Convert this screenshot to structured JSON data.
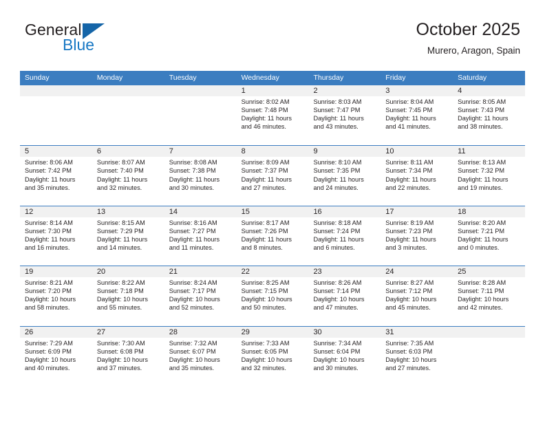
{
  "brand": {
    "name_part1": "General",
    "name_part2": "Blue",
    "accent_color": "#1878c4",
    "triangle_color": "#1565a8"
  },
  "header": {
    "title": "October 2025",
    "subtitle": "Murero, Aragon, Spain",
    "header_bar_color": "#3b7dc0"
  },
  "weekdays": [
    "Sunday",
    "Monday",
    "Tuesday",
    "Wednesday",
    "Thursday",
    "Friday",
    "Saturday"
  ],
  "weeks": [
    [
      {
        "day": "",
        "sunrise": "",
        "sunset": "",
        "daylight1": "",
        "daylight2": ""
      },
      {
        "day": "",
        "sunrise": "",
        "sunset": "",
        "daylight1": "",
        "daylight2": ""
      },
      {
        "day": "",
        "sunrise": "",
        "sunset": "",
        "daylight1": "",
        "daylight2": ""
      },
      {
        "day": "1",
        "sunrise": "Sunrise: 8:02 AM",
        "sunset": "Sunset: 7:48 PM",
        "daylight1": "Daylight: 11 hours",
        "daylight2": "and 46 minutes."
      },
      {
        "day": "2",
        "sunrise": "Sunrise: 8:03 AM",
        "sunset": "Sunset: 7:47 PM",
        "daylight1": "Daylight: 11 hours",
        "daylight2": "and 43 minutes."
      },
      {
        "day": "3",
        "sunrise": "Sunrise: 8:04 AM",
        "sunset": "Sunset: 7:45 PM",
        "daylight1": "Daylight: 11 hours",
        "daylight2": "and 41 minutes."
      },
      {
        "day": "4",
        "sunrise": "Sunrise: 8:05 AM",
        "sunset": "Sunset: 7:43 PM",
        "daylight1": "Daylight: 11 hours",
        "daylight2": "and 38 minutes."
      }
    ],
    [
      {
        "day": "5",
        "sunrise": "Sunrise: 8:06 AM",
        "sunset": "Sunset: 7:42 PM",
        "daylight1": "Daylight: 11 hours",
        "daylight2": "and 35 minutes."
      },
      {
        "day": "6",
        "sunrise": "Sunrise: 8:07 AM",
        "sunset": "Sunset: 7:40 PM",
        "daylight1": "Daylight: 11 hours",
        "daylight2": "and 32 minutes."
      },
      {
        "day": "7",
        "sunrise": "Sunrise: 8:08 AM",
        "sunset": "Sunset: 7:38 PM",
        "daylight1": "Daylight: 11 hours",
        "daylight2": "and 30 minutes."
      },
      {
        "day": "8",
        "sunrise": "Sunrise: 8:09 AM",
        "sunset": "Sunset: 7:37 PM",
        "daylight1": "Daylight: 11 hours",
        "daylight2": "and 27 minutes."
      },
      {
        "day": "9",
        "sunrise": "Sunrise: 8:10 AM",
        "sunset": "Sunset: 7:35 PM",
        "daylight1": "Daylight: 11 hours",
        "daylight2": "and 24 minutes."
      },
      {
        "day": "10",
        "sunrise": "Sunrise: 8:11 AM",
        "sunset": "Sunset: 7:34 PM",
        "daylight1": "Daylight: 11 hours",
        "daylight2": "and 22 minutes."
      },
      {
        "day": "11",
        "sunrise": "Sunrise: 8:13 AM",
        "sunset": "Sunset: 7:32 PM",
        "daylight1": "Daylight: 11 hours",
        "daylight2": "and 19 minutes."
      }
    ],
    [
      {
        "day": "12",
        "sunrise": "Sunrise: 8:14 AM",
        "sunset": "Sunset: 7:30 PM",
        "daylight1": "Daylight: 11 hours",
        "daylight2": "and 16 minutes."
      },
      {
        "day": "13",
        "sunrise": "Sunrise: 8:15 AM",
        "sunset": "Sunset: 7:29 PM",
        "daylight1": "Daylight: 11 hours",
        "daylight2": "and 14 minutes."
      },
      {
        "day": "14",
        "sunrise": "Sunrise: 8:16 AM",
        "sunset": "Sunset: 7:27 PM",
        "daylight1": "Daylight: 11 hours",
        "daylight2": "and 11 minutes."
      },
      {
        "day": "15",
        "sunrise": "Sunrise: 8:17 AM",
        "sunset": "Sunset: 7:26 PM",
        "daylight1": "Daylight: 11 hours",
        "daylight2": "and 8 minutes."
      },
      {
        "day": "16",
        "sunrise": "Sunrise: 8:18 AM",
        "sunset": "Sunset: 7:24 PM",
        "daylight1": "Daylight: 11 hours",
        "daylight2": "and 6 minutes."
      },
      {
        "day": "17",
        "sunrise": "Sunrise: 8:19 AM",
        "sunset": "Sunset: 7:23 PM",
        "daylight1": "Daylight: 11 hours",
        "daylight2": "and 3 minutes."
      },
      {
        "day": "18",
        "sunrise": "Sunrise: 8:20 AM",
        "sunset": "Sunset: 7:21 PM",
        "daylight1": "Daylight: 11 hours",
        "daylight2": "and 0 minutes."
      }
    ],
    [
      {
        "day": "19",
        "sunrise": "Sunrise: 8:21 AM",
        "sunset": "Sunset: 7:20 PM",
        "daylight1": "Daylight: 10 hours",
        "daylight2": "and 58 minutes."
      },
      {
        "day": "20",
        "sunrise": "Sunrise: 8:22 AM",
        "sunset": "Sunset: 7:18 PM",
        "daylight1": "Daylight: 10 hours",
        "daylight2": "and 55 minutes."
      },
      {
        "day": "21",
        "sunrise": "Sunrise: 8:24 AM",
        "sunset": "Sunset: 7:17 PM",
        "daylight1": "Daylight: 10 hours",
        "daylight2": "and 52 minutes."
      },
      {
        "day": "22",
        "sunrise": "Sunrise: 8:25 AM",
        "sunset": "Sunset: 7:15 PM",
        "daylight1": "Daylight: 10 hours",
        "daylight2": "and 50 minutes."
      },
      {
        "day": "23",
        "sunrise": "Sunrise: 8:26 AM",
        "sunset": "Sunset: 7:14 PM",
        "daylight1": "Daylight: 10 hours",
        "daylight2": "and 47 minutes."
      },
      {
        "day": "24",
        "sunrise": "Sunrise: 8:27 AM",
        "sunset": "Sunset: 7:12 PM",
        "daylight1": "Daylight: 10 hours",
        "daylight2": "and 45 minutes."
      },
      {
        "day": "25",
        "sunrise": "Sunrise: 8:28 AM",
        "sunset": "Sunset: 7:11 PM",
        "daylight1": "Daylight: 10 hours",
        "daylight2": "and 42 minutes."
      }
    ],
    [
      {
        "day": "26",
        "sunrise": "Sunrise: 7:29 AM",
        "sunset": "Sunset: 6:09 PM",
        "daylight1": "Daylight: 10 hours",
        "daylight2": "and 40 minutes."
      },
      {
        "day": "27",
        "sunrise": "Sunrise: 7:30 AM",
        "sunset": "Sunset: 6:08 PM",
        "daylight1": "Daylight: 10 hours",
        "daylight2": "and 37 minutes."
      },
      {
        "day": "28",
        "sunrise": "Sunrise: 7:32 AM",
        "sunset": "Sunset: 6:07 PM",
        "daylight1": "Daylight: 10 hours",
        "daylight2": "and 35 minutes."
      },
      {
        "day": "29",
        "sunrise": "Sunrise: 7:33 AM",
        "sunset": "Sunset: 6:05 PM",
        "daylight1": "Daylight: 10 hours",
        "daylight2": "and 32 minutes."
      },
      {
        "day": "30",
        "sunrise": "Sunrise: 7:34 AM",
        "sunset": "Sunset: 6:04 PM",
        "daylight1": "Daylight: 10 hours",
        "daylight2": "and 30 minutes."
      },
      {
        "day": "31",
        "sunrise": "Sunrise: 7:35 AM",
        "sunset": "Sunset: 6:03 PM",
        "daylight1": "Daylight: 10 hours",
        "daylight2": "and 27 minutes."
      },
      {
        "day": "",
        "sunrise": "",
        "sunset": "",
        "daylight1": "",
        "daylight2": ""
      }
    ]
  ]
}
